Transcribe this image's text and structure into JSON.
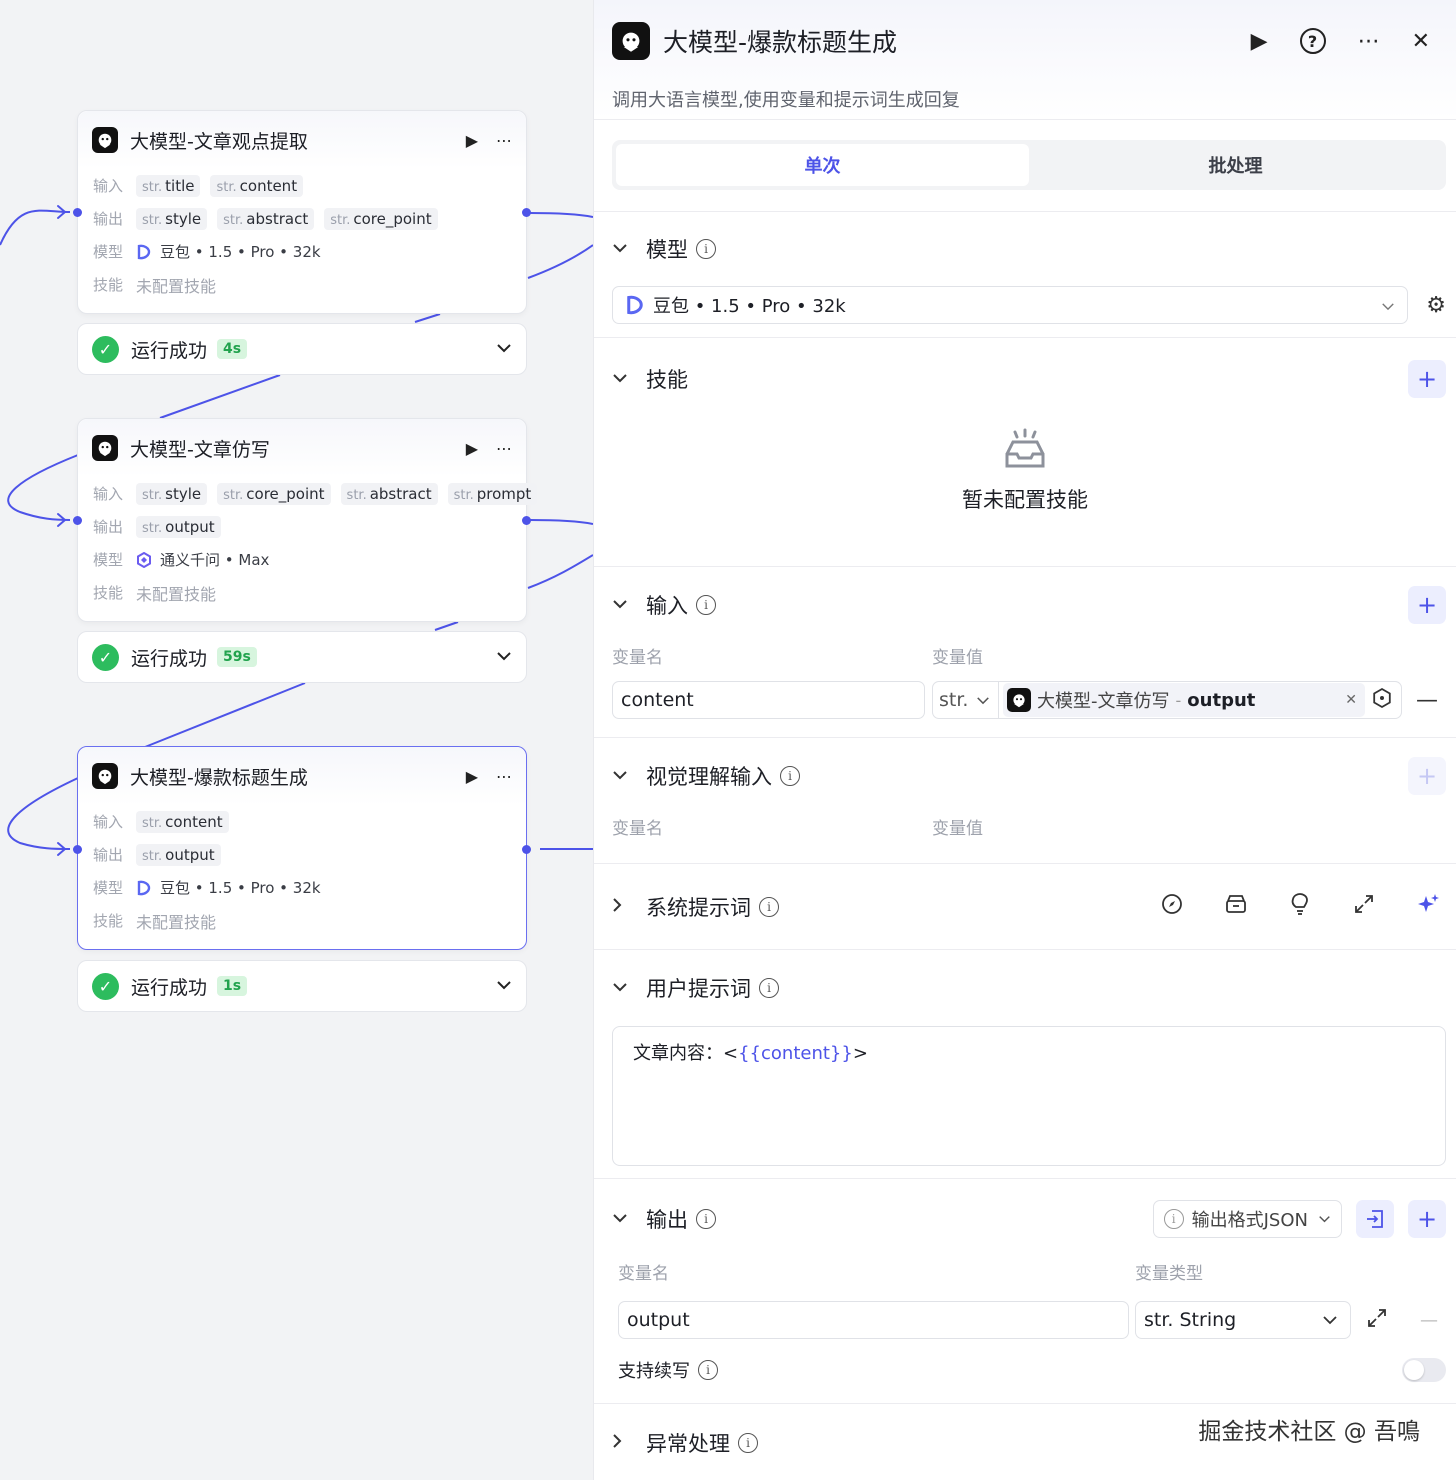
{
  "colors": {
    "accent": "#4d53e8",
    "success": "#2dbc5e",
    "edge": "#4d53e8"
  },
  "canvas": {
    "labels": {
      "input": "输入",
      "output": "输出",
      "model": "模型",
      "skill": "技能",
      "str": "str."
    },
    "nodes": [
      {
        "title": "大模型-文章观点提取",
        "inputs": [
          "title",
          "content"
        ],
        "outputs": [
          "style",
          "abstract",
          "core_point"
        ],
        "model": "豆包 • 1.5 • Pro • 32k",
        "model_icon": "doubao-icon",
        "skill": "未配置技能",
        "status": "运行成功",
        "duration": "4s"
      },
      {
        "title": "大模型-文章仿写",
        "inputs": [
          "style",
          "core_point",
          "abstract",
          "prompt"
        ],
        "outputs": [
          "output"
        ],
        "model": "通义千问 • Max",
        "model_icon": "qwen-icon",
        "skill": "未配置技能",
        "status": "运行成功",
        "duration": "59s"
      },
      {
        "title": "大模型-爆款标题生成",
        "inputs": [
          "content"
        ],
        "outputs": [
          "output"
        ],
        "model": "豆包 • 1.5 • Pro • 32k",
        "model_icon": "doubao-icon",
        "skill": "未配置技能",
        "status": "运行成功",
        "duration": "1s"
      }
    ]
  },
  "panel": {
    "title": "大模型-爆款标题生成",
    "description": "调用大语言模型,使用变量和提示词生成回复",
    "tabs": [
      "单次",
      "批处理"
    ],
    "model": {
      "title": "模型",
      "value": "豆包 • 1.5 • Pro • 32k"
    },
    "skills": {
      "title": "技能",
      "empty": "暂未配置技能"
    },
    "input": {
      "title": "输入",
      "col_name": "变量名",
      "col_value": "变量值",
      "var_name": "content",
      "type": "str.",
      "ref_node": "大模型-文章仿写",
      "ref_sep": "-",
      "ref_var": "output"
    },
    "vision": {
      "title": "视觉理解输入",
      "col_name": "变量名",
      "col_value": "变量值"
    },
    "system_prompt": {
      "title": "系统提示词"
    },
    "user_prompt": {
      "title": "用户提示词",
      "prefix": "文章内容：<",
      "variable": "{{content}}",
      "suffix": ">"
    },
    "output": {
      "title": "输出",
      "format": "输出格式JSON",
      "col_name": "变量名",
      "col_type": "变量类型",
      "var_name": "output",
      "var_type": "str. String",
      "continue_label": "支持续写"
    },
    "exception": {
      "title": "异常处理"
    }
  },
  "watermark": "掘金技术社区 @ 吾鳴"
}
